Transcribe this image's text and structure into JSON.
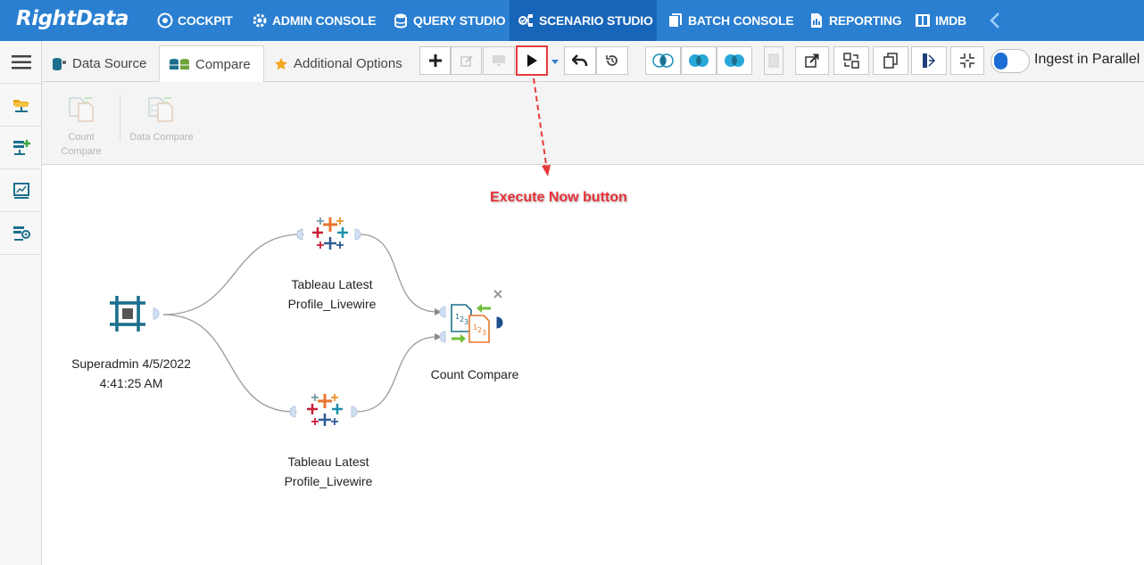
{
  "app": {
    "logo": "RightData"
  },
  "nav": {
    "items": [
      {
        "label": "COCKPIT",
        "icon": "cockpit-icon"
      },
      {
        "label": "ADMIN CONSOLE",
        "icon": "gear-icon"
      },
      {
        "label": "QUERY STUDIO",
        "icon": "database-icon"
      },
      {
        "label": "SCENARIO STUDIO",
        "icon": "scenario-icon",
        "active": true
      },
      {
        "label": "BATCH CONSOLE",
        "icon": "batch-icon"
      },
      {
        "label": "REPORTING",
        "icon": "report-icon"
      },
      {
        "label": "IMDB",
        "icon": "imdb-icon"
      }
    ]
  },
  "tabs": [
    {
      "label": "Data Source",
      "icon": "database-plug-icon"
    },
    {
      "label": "Compare",
      "icon": "compare-db-icon",
      "active": true
    },
    {
      "label": "Additional Options",
      "icon": "star-icon"
    }
  ],
  "toolbar": {
    "ingest_label": "Ingest in Parallel",
    "ingest_enabled": false
  },
  "ribbon": {
    "count_compare": "Count Compare",
    "data_compare": "Data Compare"
  },
  "canvas": {
    "start_node": {
      "line1": "Superadmin 4/5/2022",
      "line2": "4:41:25 AM"
    },
    "source_top": {
      "line1": "Tableau Latest",
      "line2": "Profile_Livewire"
    },
    "source_bottom": {
      "line1": "Tableau Latest",
      "line2": "Profile_Livewire"
    },
    "compare_node": {
      "label": "Count Compare"
    }
  },
  "annotation": {
    "text": "Execute Now button"
  },
  "colors": {
    "nav_bg": "#2a7fd1",
    "nav_active": "#1765b8",
    "accent_red": "#e53b3b",
    "teal": "#1c6f8c"
  }
}
